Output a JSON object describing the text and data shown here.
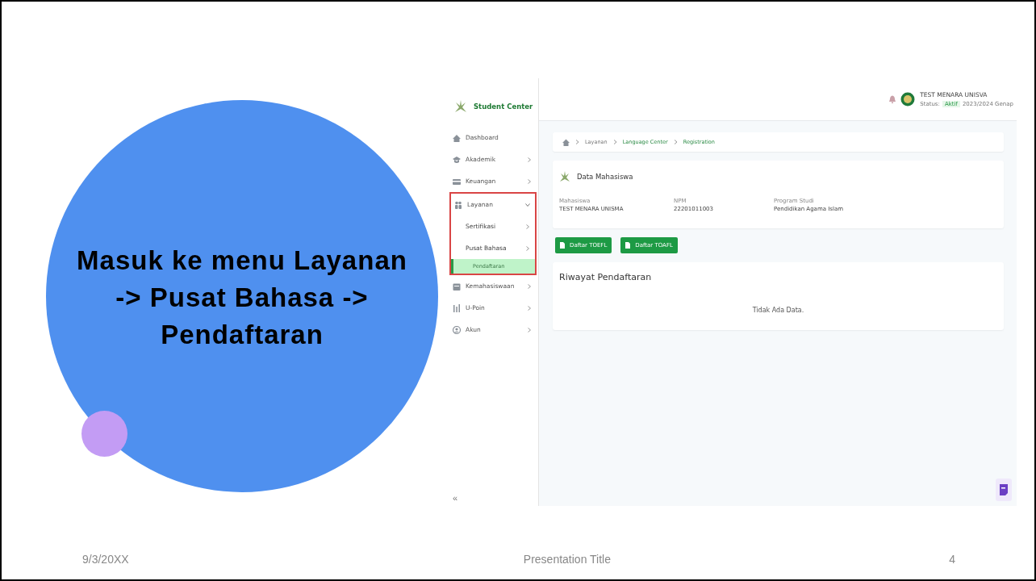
{
  "slide": {
    "heading": "Masuk ke menu Layanan -> Pusat Bahasa -> Pendaftaran",
    "footer": {
      "date": "9/3/20XX",
      "title": "Presentation Title",
      "page": "4"
    }
  },
  "app": {
    "brand": "Student Center",
    "sidebar": {
      "items": [
        {
          "label": "Dashboard",
          "has_arrow": false
        },
        {
          "label": "Akademik",
          "has_arrow": true,
          "expanded": false
        },
        {
          "label": "Keuangan",
          "has_arrow": true,
          "expanded": false
        },
        {
          "label": "Layanan",
          "has_arrow": true,
          "expanded": true,
          "highlighted": true,
          "children": [
            {
              "label": "Sertifikasi",
              "has_arrow": true,
              "selected": false
            },
            {
              "label": "Pusat Bahasa",
              "has_arrow": true,
              "selected": false,
              "children": [
                {
                  "label": "Pendaftaran",
                  "selected": true
                }
              ]
            }
          ]
        },
        {
          "label": "Kemahasiswaan",
          "has_arrow": true,
          "expanded": false
        },
        {
          "label": "U-Poin",
          "has_arrow": true,
          "expanded": false
        },
        {
          "label": "Akun",
          "has_arrow": true,
          "expanded": false
        }
      ],
      "collapse": "«"
    },
    "header": {
      "user_name": "TEST MENARA UNISVA",
      "status_label": "Status:",
      "status": "Aktif",
      "period": "2023/2024 Genap"
    },
    "breadcrumb": [
      {
        "label": "Layanan",
        "active": false
      },
      {
        "label": "Language Center",
        "active": true
      },
      {
        "label": "Registration",
        "active": true
      }
    ],
    "student_card": {
      "title": "Data Mahasiswa",
      "fields": [
        {
          "label": "Mahasiswa",
          "value": "TEST MENARA UNISMA"
        },
        {
          "label": "NPM",
          "value": "22201011003"
        },
        {
          "label": "Program Studi",
          "value": "Pendidikan Agama Islam"
        }
      ]
    },
    "buttons": [
      "Daftar TOEFL",
      "Daftar TOAFL"
    ],
    "history": {
      "title": "Riwayat Pendaftaran",
      "empty": "Tidak Ada Data."
    }
  }
}
